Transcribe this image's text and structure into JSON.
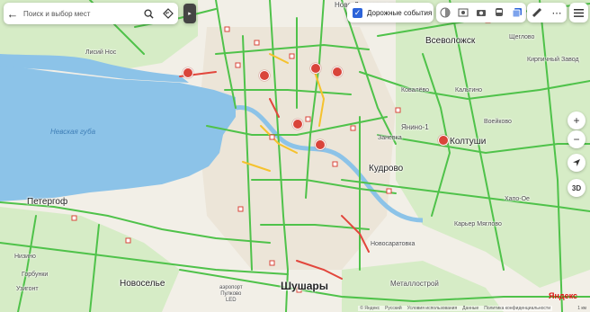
{
  "search": {
    "placeholder": "Поиск и выбор мест"
  },
  "layers": {
    "traffic_events_label": "Дорожные события",
    "checked": true
  },
  "labels": {
    "water": "Невская губа",
    "novo_devyatkino": "Ново-Девяткино",
    "vsevolozhsk": "Всеволожск",
    "shcheglovo": "Щеглово",
    "kirpichny": "Кирпичный Завод",
    "lisiy_nos": "Лисий Нос",
    "kovalyovo": "Ковалёво",
    "kaltino": "Кальтино",
    "voeikovo": "Воейково",
    "yanino": "Янино-1",
    "zanevka": "Заневка",
    "koltushi": "Колтуши",
    "kudrovo": "Кудрово",
    "peterhof": "Петергоф",
    "novosaratovka": "Новосаратовка",
    "karer": "Карьер Мяглово",
    "xapo_oe": "Хапо-Ое",
    "nizino": "Низино",
    "gorbunki": "Горбунки",
    "uzigont": "Узигонт",
    "novoselye": "Новоселье",
    "airport": "аэропорт\nПулково\nLED",
    "shushary": "Шушары",
    "metallostroy": "Металлострой"
  },
  "footer": {
    "yandex": "© Яндекс",
    "lang": "Русский",
    "terms": "Условия использования",
    "data": "Данные",
    "privacy": "Политика конфиденциальности"
  },
  "logo": "Яндекс",
  "scale": "1 км",
  "controls": {
    "zoom_in": "+",
    "zoom_out": "−",
    "three_d": "3D"
  },
  "colors": {
    "water": "#8cc3e8",
    "land": "#f2efe7",
    "forest": "#d6ecc6",
    "traffic_green": "#4fc24a",
    "traffic_yellow": "#f5c22d",
    "traffic_red": "#e2463c"
  }
}
